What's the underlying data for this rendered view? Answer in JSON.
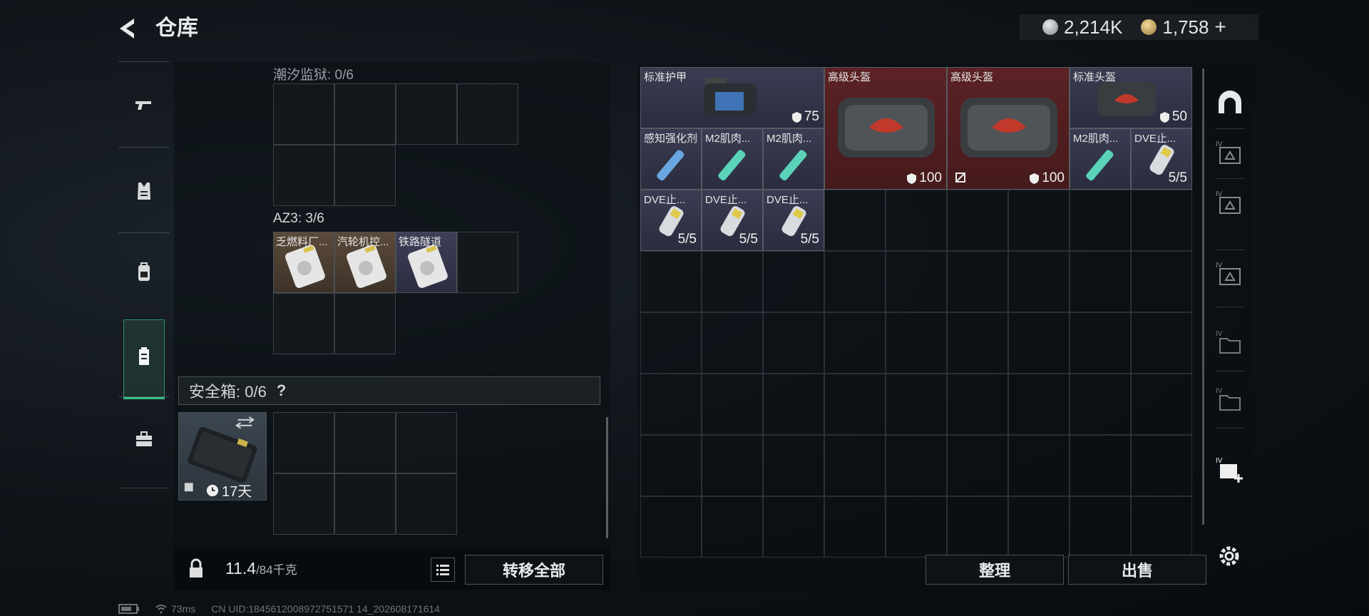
{
  "header": {
    "title": "仓库"
  },
  "currency": {
    "silver": "2,214K",
    "gold": "1,758",
    "add": "+"
  },
  "left_nav": {
    "items": [
      "weapon-icon",
      "vest-icon",
      "backpack-icon",
      "container-icon",
      "toolbox-icon"
    ]
  },
  "left_panel": {
    "section1": {
      "label": "潮汐监狱: 0/6"
    },
    "section2": {
      "label": "AZ3: 3/6",
      "items": [
        {
          "name": "乏燃料厂..."
        },
        {
          "name": "汽轮机控..."
        },
        {
          "name": "铁路隧道"
        }
      ]
    },
    "safe_box": {
      "label": "安全箱: 0/6",
      "help": "?",
      "timer": "17天"
    }
  },
  "weight": {
    "current": "11.4",
    "max": "/84千克"
  },
  "buttons": {
    "transfer_all": "转移全部",
    "sort": "整理",
    "sell": "出售"
  },
  "stash": {
    "items": [
      {
        "name": "标准护甲",
        "value": "75"
      },
      {
        "name": "高级头盔",
        "value": "100"
      },
      {
        "name": "高级头盔",
        "value": "100"
      },
      {
        "name": "标准头盔",
        "value": "50"
      },
      {
        "name": "感知强化剂"
      },
      {
        "name": "M2肌肉..."
      },
      {
        "name": "M2肌肉..."
      },
      {
        "name": "M2肌肉..."
      },
      {
        "name": "DVE止...",
        "value": "5/5"
      },
      {
        "name": "DVE止...",
        "value": "5/5"
      },
      {
        "name": "DVE止...",
        "value": "5/5"
      },
      {
        "name": "DVE止...",
        "value": "5/5"
      }
    ]
  },
  "status": {
    "ping": "73ms",
    "uid": "CN UID:1845612008972751571 14_202608171614"
  }
}
